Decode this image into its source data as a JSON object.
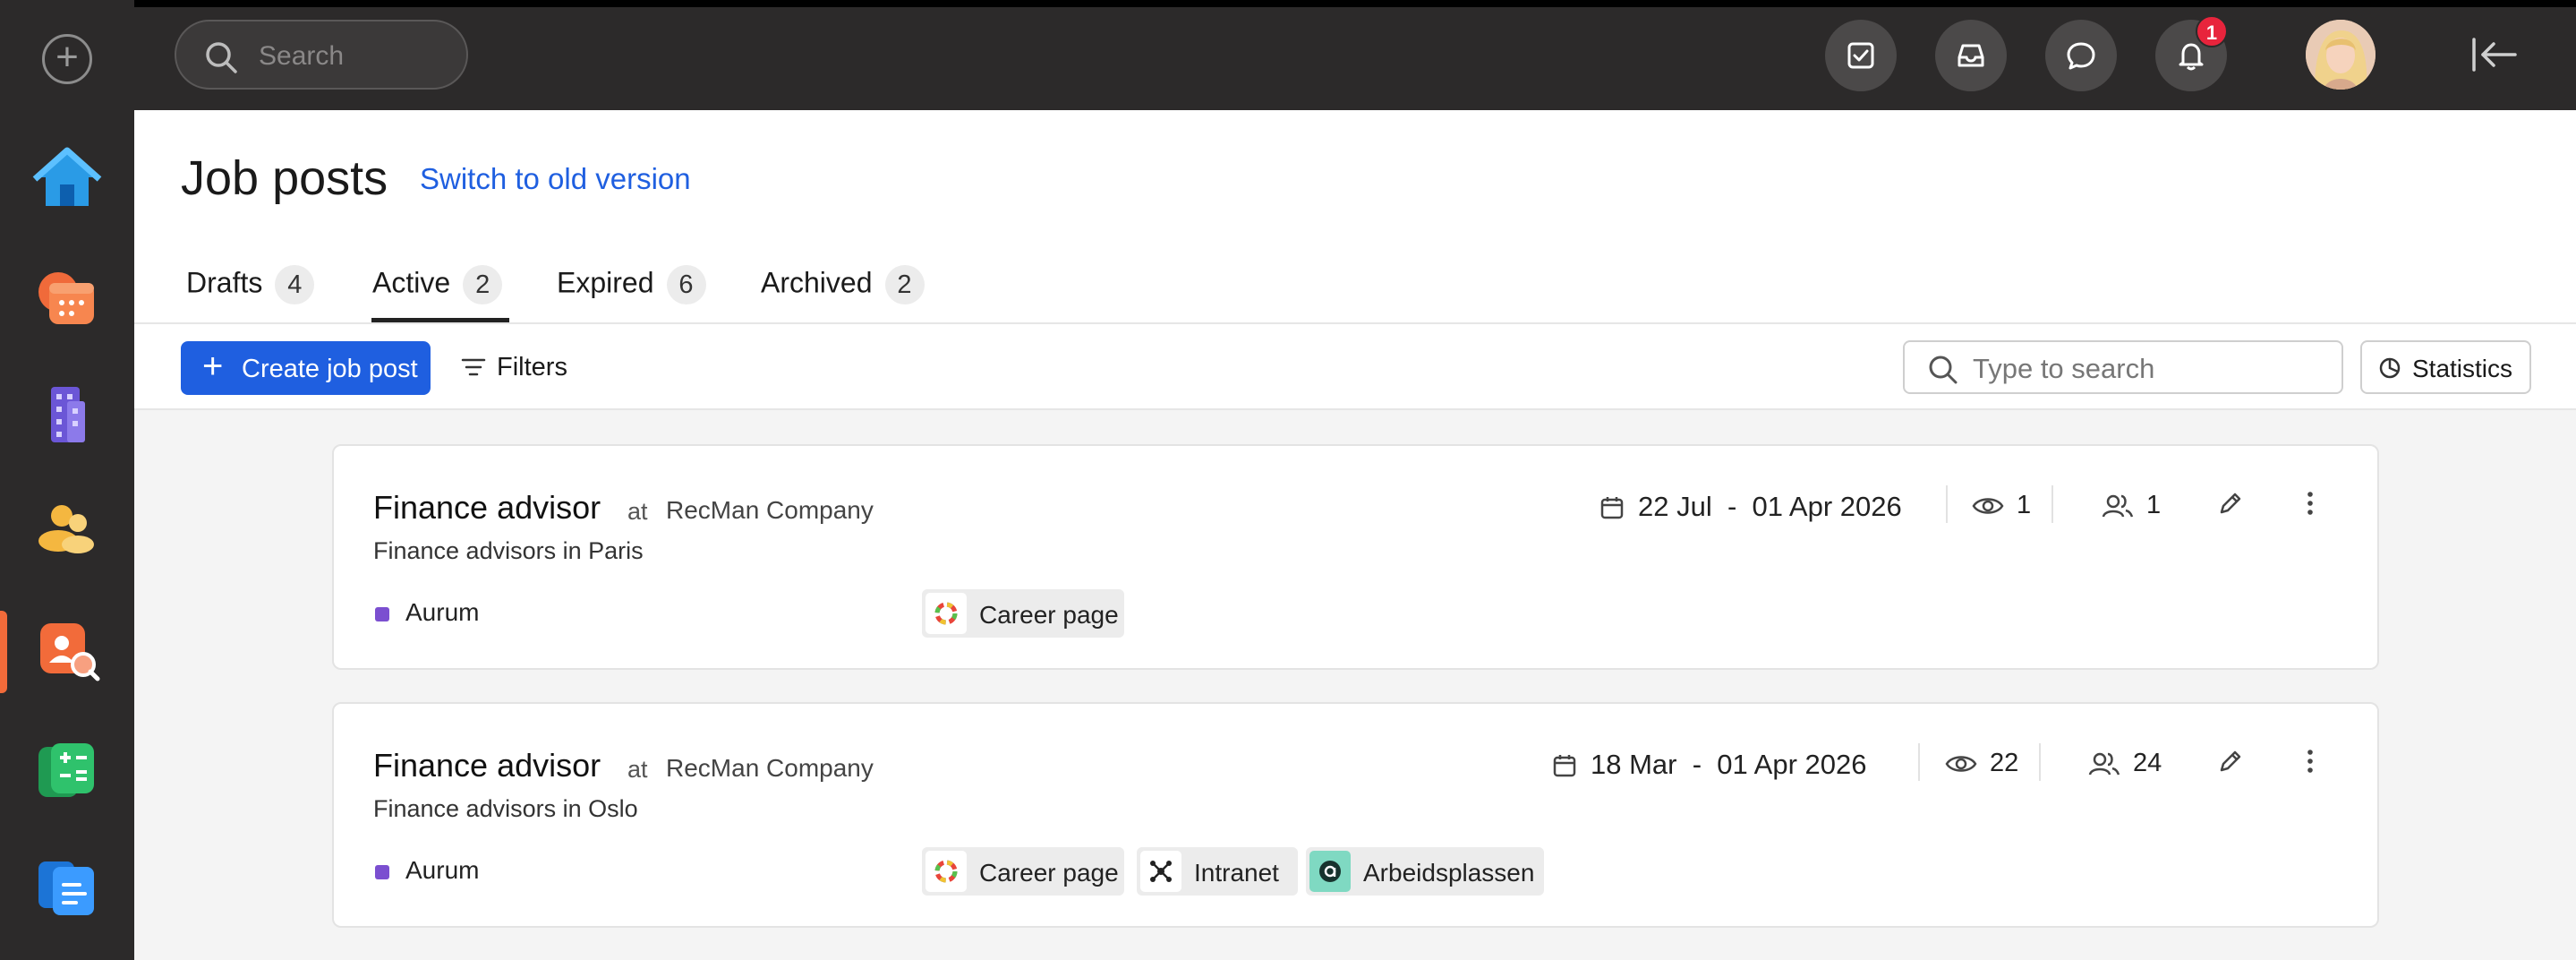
{
  "topbar": {
    "search_placeholder": "Search",
    "notification_count": "1"
  },
  "colors": {
    "accent": "#1f5fe0",
    "sidebar_bg": "#2c2a2a",
    "brand_dot": "#7b4fd0",
    "badge": "#e8243c"
  },
  "sidebar": {
    "items": [
      {
        "icon": "home-icon"
      },
      {
        "icon": "calendar-icon"
      },
      {
        "icon": "building-icon"
      },
      {
        "icon": "people-icon"
      },
      {
        "icon": "candidate-search-icon",
        "active": true
      },
      {
        "icon": "calculator-icon"
      },
      {
        "icon": "documents-icon"
      }
    ]
  },
  "header": {
    "title": "Job posts",
    "old_version_link": "Switch to old version"
  },
  "tabs": [
    {
      "label": "Drafts",
      "count": "4"
    },
    {
      "label": "Active",
      "count": "2",
      "active": true
    },
    {
      "label": "Expired",
      "count": "6"
    },
    {
      "label": "Archived",
      "count": "2"
    }
  ],
  "toolbar": {
    "create_label": "Create job post",
    "filters_label": "Filters",
    "search_placeholder": "Type to search",
    "statistics_label": "Statistics"
  },
  "jobs": [
    {
      "title": "Finance advisor",
      "at": "at",
      "company": "RecMan Company",
      "subtitle": "Finance advisors in Paris",
      "brand": "Aurum",
      "date_start": "22 Jul",
      "date_sep": "-",
      "date_end": "01 Apr 2026",
      "views": "1",
      "applicants": "1",
      "channels": [
        "Career page"
      ]
    },
    {
      "title": "Finance advisor",
      "at": "at",
      "company": "RecMan Company",
      "subtitle": "Finance advisors in Oslo",
      "brand": "Aurum",
      "date_start": "18 Mar",
      "date_sep": "-",
      "date_end": "01 Apr 2026",
      "views": "22",
      "applicants": "24",
      "channels": [
        "Career page",
        "Intranet",
        "Arbeidsplassen"
      ]
    }
  ]
}
